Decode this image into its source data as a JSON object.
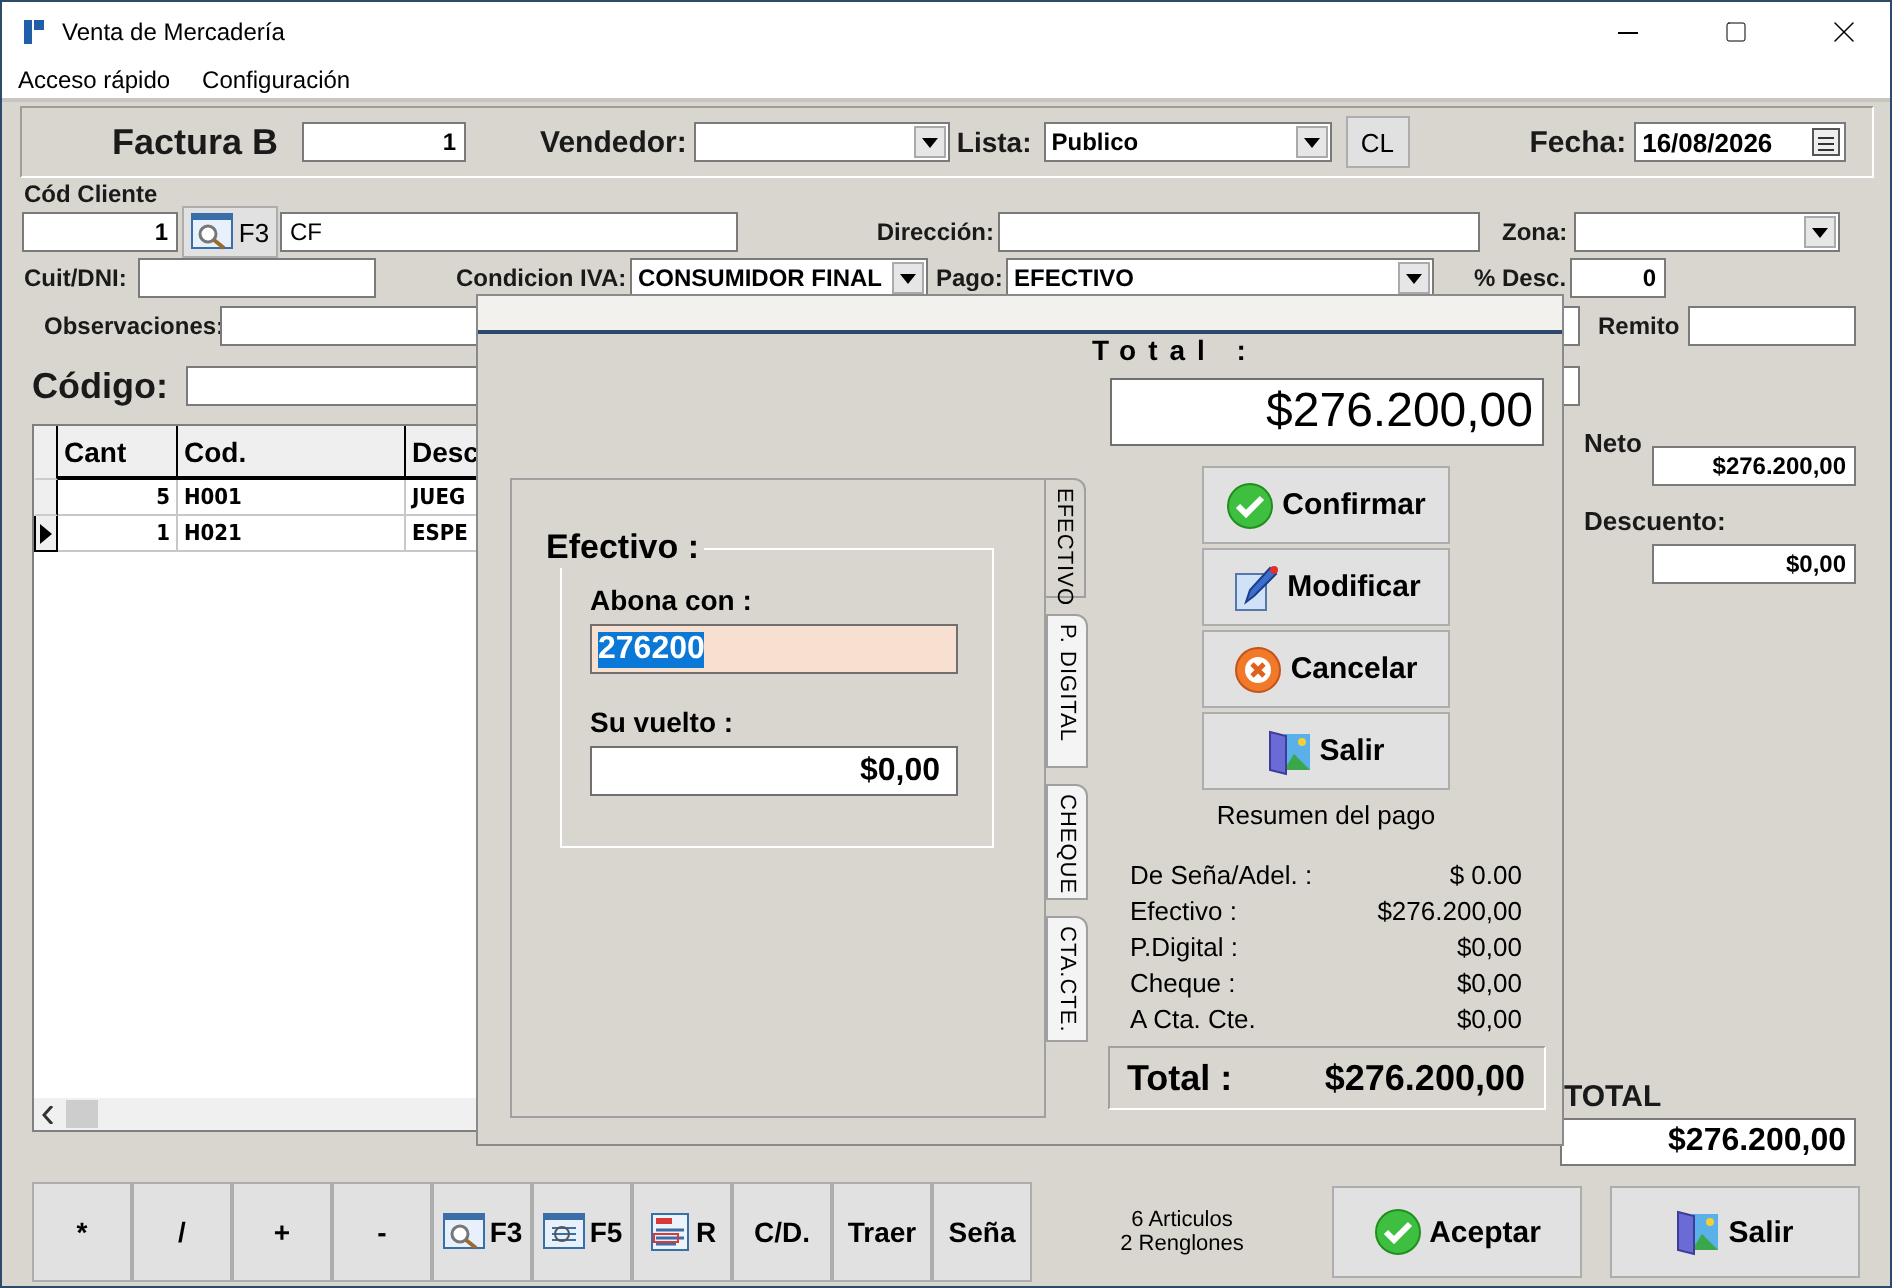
{
  "window": {
    "title": "Venta de Mercadería"
  },
  "menu": [
    "Acceso rápido",
    "Configuración"
  ],
  "header": {
    "title": "Factura B",
    "number": "1",
    "vendedor_label": "Vendedor:",
    "lista_label": "Lista:",
    "lista": "Publico",
    "cl_button": "CL",
    "fecha_label": "Fecha:",
    "fecha": "16/08/2026"
  },
  "client": {
    "code_label": "Cód Cliente",
    "code": "1",
    "search_key": "F3",
    "name": "CF",
    "direccion_label": "Dirección:",
    "zona_label": "Zona:",
    "cuit_label": "Cuit/DNI:",
    "iva_label": "Condicion IVA:",
    "iva": "CONSUMIDOR FINAL",
    "pago_label": "Pago:",
    "pago": "EFECTIVO",
    "desc_label": "% Desc.",
    "desc": "0",
    "obs_label": "Observaciones:",
    "remito_label": "Remito"
  },
  "codigo_label": "Código:",
  "table": {
    "columns": [
      "Cant",
      "Cod.",
      "Desc"
    ],
    "rows": [
      {
        "cells": [
          "5",
          "H001",
          "JUEG"
        ],
        "selected": false
      },
      {
        "cells": [
          "1",
          "H021",
          "ESPE"
        ],
        "selected": true
      }
    ]
  },
  "totals": {
    "neto_label": "Neto",
    "neto": "$276.200,00",
    "descuento_label": "Descuento:",
    "descuento": "$0,00",
    "total_label": "TOTAL",
    "total": "$276.200,00"
  },
  "toolbar": [
    {
      "label": "*",
      "kind": "plain"
    },
    {
      "label": "/",
      "kind": "plain"
    },
    {
      "label": "+",
      "kind": "plain"
    },
    {
      "label": "-",
      "kind": "plain"
    },
    {
      "label": "F3",
      "kind": "search"
    },
    {
      "label": "F5",
      "kind": "list"
    },
    {
      "label": "R",
      "kind": "form"
    },
    {
      "label": "C/D.",
      "kind": "plain"
    },
    {
      "label": "Traer",
      "kind": "plain"
    },
    {
      "label": "Seña",
      "kind": "plain"
    }
  ],
  "info": [
    "6 Articulos",
    "2 Renglones"
  ],
  "actions": [
    {
      "label": "Aceptar",
      "kind": "check"
    },
    {
      "label": "Salir",
      "kind": "door"
    }
  ],
  "payment_dialog": {
    "total_label": "Total :",
    "total": "$276.200,00",
    "tabs": [
      {
        "label": "EFECTIVO",
        "selected": true
      },
      {
        "label": "P. DIGITAL",
        "selected": false
      },
      {
        "label": "CHEQUE",
        "selected": false
      },
      {
        "label": "CTA.CTE.",
        "selected": false
      }
    ],
    "group_title": "Efectivo :",
    "abona_label": "Abona con :",
    "abona_value": "276200",
    "vuelto_label": "Su vuelto :",
    "vuelto": "$0,00",
    "buttons": [
      {
        "label": "Confirmar",
        "kind": "check"
      },
      {
        "label": "Modificar",
        "kind": "edit"
      },
      {
        "label": "Cancelar",
        "kind": "cancel"
      },
      {
        "label": "Salir",
        "kind": "door"
      }
    ],
    "summary_title": "Resumen del pago",
    "summary": [
      {
        "label": "De Seña/Adel. :",
        "value": "$ 0.00"
      },
      {
        "label": "Efectivo :",
        "value": "$276.200,00"
      },
      {
        "label": "P.Digital :",
        "value": "$0,00"
      },
      {
        "label": "Cheque :",
        "value": "$0,00"
      },
      {
        "label": "A Cta. Cte.",
        "value": "$0,00"
      }
    ],
    "grand_total_label": "Total :",
    "grand_total": "$276.200,00"
  }
}
